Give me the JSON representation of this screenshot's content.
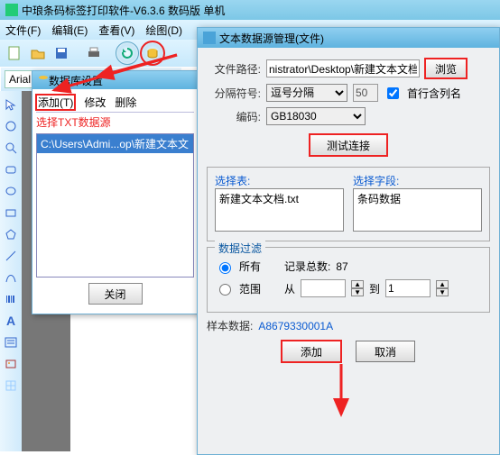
{
  "app": {
    "title": "中琅条码标签打印软件-V6.3.6 数码版 单机"
  },
  "menu": {
    "file": "文件(F)",
    "edit": "编辑(E)",
    "view": "查看(V)",
    "draw": "绘图(D)"
  },
  "font": {
    "family": "Arial"
  },
  "popup1": {
    "title": "数据库设置",
    "add": "添加(T)",
    "modify": "修改",
    "delete": "删除",
    "note": "选择TXT数据源",
    "item": "C:\\Users\\Admi...op\\新建文本文",
    "close": "关闭"
  },
  "dlg": {
    "title": "文本数据源管理(文件)",
    "path_label": "文件路径:",
    "path_value": "nistrator\\Desktop\\新建文本文档.txt",
    "browse": "浏览",
    "sep_label": "分隔符号:",
    "sep_value": "逗号分隔",
    "sep_num": "50",
    "firstrow": "首行含列名",
    "enc_label": "编码:",
    "enc_value": "GB18030",
    "test": "测试连接",
    "select_sheet": "选择表:",
    "select_field": "选择字段:",
    "sheet_item": "新建文本文档.txt",
    "field_item": "条码数据",
    "filter": "数据过滤",
    "all": "所有",
    "range": "范围",
    "total_label": "记录总数:",
    "total_value": "87",
    "from": "从",
    "to": "到",
    "range_to_value": "1",
    "sample_label": "样本数据:",
    "sample_value": "A8679330001A",
    "ok": "添加",
    "cancel": "取消"
  }
}
